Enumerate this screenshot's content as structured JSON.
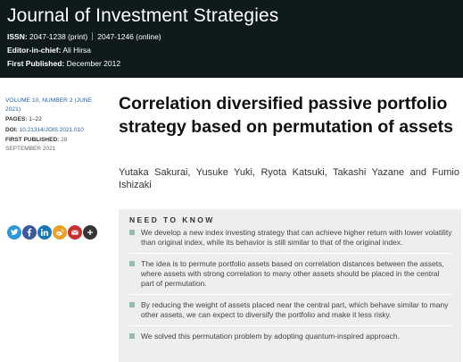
{
  "header": {
    "journal_title": "Journal of Investment Strategies",
    "issn_label": "ISSN:",
    "issn_print": "2047-1238 (print)",
    "issn_online": "2047-1246 (online)",
    "editor_label": "Editor-in-chief:",
    "editor_value": "Ali Hirsa",
    "first_published_label": "First Published:",
    "first_published_value": "December 2012"
  },
  "article_meta": {
    "volume": "VOLUME 10, NUMBER 2 (JUNE 2021)",
    "pages_label": "PAGES:",
    "pages_value": "1–22",
    "doi_label": "DOI:",
    "doi_value": "10.21314/JOIS.2021.010",
    "first_published_label": "FIRST PUBLISHED:",
    "first_published_value": "28 SEPTEMBER 2021"
  },
  "article": {
    "title": "Correlation diversified passive portfolio strategy based on permutation of assets",
    "authors": "Yutaka Sakurai, Yusuke Yuki, Ryota Katsuki, Takashi Yazane and Fumio Ishizaki"
  },
  "share": [
    {
      "icon": "twitter-icon",
      "color": "#2c9ad8",
      "glyph": "t"
    },
    {
      "icon": "facebook-icon",
      "color": "#3a5a98",
      "glyph": "f"
    },
    {
      "icon": "linkedin-icon",
      "color": "#1a78b3",
      "glyph": "in"
    },
    {
      "icon": "weibo-icon",
      "color": "#e8a12a",
      "glyph": "w"
    },
    {
      "icon": "email-icon",
      "color": "#c8302c",
      "glyph": "✉"
    },
    {
      "icon": "share-icon",
      "color": "#353535",
      "glyph": "+"
    }
  ],
  "need_to_know": {
    "heading": "NEED TO KNOW",
    "items": [
      "We develop a new index investing strategy that can achieve higher return with lower volatility than original index, while its behavior is still similar to that of the original index.",
      "The idea is to permute portfolio assets based on correlation distances between the assets, where assets with strong correlation to many other assets should be placed in the central part of permutation.",
      "By reducing the weight of assets placed near the central part, which behave similar to many other assets, we can expect to diversify the portfolio and make it less risky.",
      "We solved this permutation problem by adopting quantum-inspired approach."
    ]
  }
}
